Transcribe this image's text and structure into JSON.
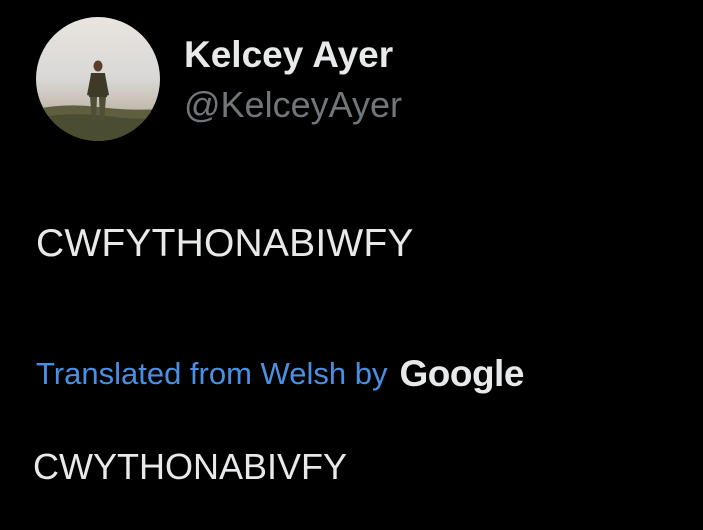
{
  "author": {
    "display_name": "Kelcey Ayer",
    "handle": "@KelceyAyer",
    "avatar_icon": "profile-photo-avatar"
  },
  "tweet": {
    "text": "CWFYTHONABIWFY"
  },
  "translation": {
    "label": "Translated from Welsh by",
    "provider": "Google",
    "text": "CWYTHONABIVFY"
  },
  "colors": {
    "background": "#000000",
    "primary_text": "#e7e9ea",
    "secondary_text": "#71767b",
    "link": "#4a90e2"
  }
}
